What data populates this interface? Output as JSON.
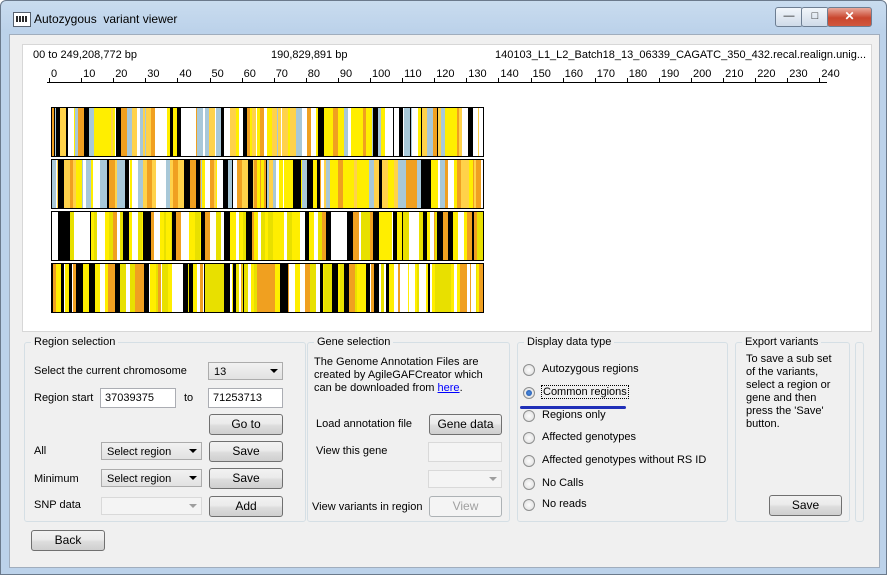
{
  "window": {
    "title": "Autozygous  variant viewer"
  },
  "viewer": {
    "range_label": "00 to 249,208,772 bp",
    "position_label": "190,829,891 bp",
    "file_label": "140103_L1_L2_Batch18_13_06339_CAGATC_350_432.recal.realign.unig...",
    "ruler_ticks": [
      "0",
      "10",
      "20",
      "30",
      "40",
      "50",
      "60",
      "70",
      "80",
      "90",
      "100",
      "110",
      "120",
      "130",
      "140",
      "150",
      "160",
      "170",
      "180",
      "190",
      "200",
      "210",
      "220",
      "230",
      "240"
    ]
  },
  "region": {
    "title": "Region selection",
    "chromosome_label": "Select the current chromosome",
    "chromosome_value": "13",
    "start_label": "Region start",
    "start_value": "37039375",
    "to_label": "to",
    "end_value": "71253713",
    "goto_label": "Go to",
    "all_label": "All",
    "all_select": "Select region",
    "all_save": "Save",
    "minimum_label": "Minimum",
    "minimum_select": "Select region",
    "minimum_save": "Save",
    "snp_label": "SNP data",
    "snp_select": "",
    "add_label": "Add"
  },
  "gene": {
    "title": "Gene selection",
    "desc1": "The Genome Annotation Files are",
    "desc2": "created by AgileGAFCreator which",
    "desc3": "can be downloaded from",
    "desc_link": "here",
    "desc_end": ".",
    "load_label": "Load annotation file",
    "gene_data_button": "Gene data",
    "view_gene_label": "View this gene",
    "view_gene_value": "",
    "gene_select": "",
    "view_variants_label": "View variants in region",
    "view_button": "View"
  },
  "display": {
    "title": "Display data type",
    "options": [
      "Autozygous regions",
      "Common regions",
      "Regions only",
      "Affected genotypes",
      "Affected genotypes without RS ID",
      "No Calls",
      "No reads"
    ],
    "selected_index": 1
  },
  "export": {
    "title": "Export variants",
    "description": "To save a sub set of the variants, select a region or gene and then press the 'Save' button.",
    "save_label": "Save"
  },
  "back_label": "Back",
  "colors": {
    "accent": "#1f2fb8",
    "track_yellow": "#ffee00",
    "track_orange": "#f0a020",
    "track_blue": "#a8c8d8"
  }
}
